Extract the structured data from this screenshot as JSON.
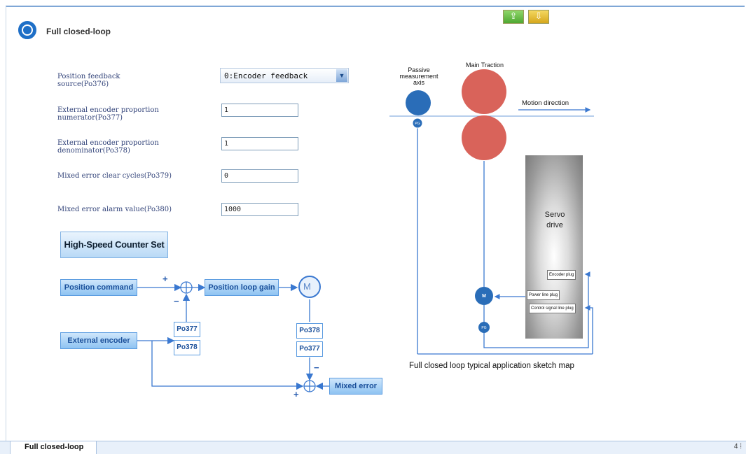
{
  "window": {
    "title": "Full closed-loop"
  },
  "toolbar": {
    "btn_upload": "⇪",
    "btn_download": "⇩"
  },
  "form": {
    "source_label": "Position feedback source(Po376)",
    "source_value": "0:Encoder feedback",
    "numerator_label": "External encoder proportion numerator(Po377)",
    "numerator_value": "1",
    "denominator_label": "External encoder proportion denominator(Po378)",
    "denominator_value": "1",
    "clear_label": "Mixed error clear cycles(Po379)",
    "clear_value": "0",
    "alarm_label": "Mixed error alarm value(Po380)",
    "alarm_value": "1000"
  },
  "hsc_button": "High-Speed Counter Set",
  "block_diagram": {
    "position_command": "Position command",
    "position_loop_gain": "Position loop gain",
    "motor": "M",
    "external_encoder": "External encoder",
    "mixed_error": "Mixed error",
    "p377_a": "Po377",
    "p378_a": "Po378",
    "p378_b": "Po378",
    "p377_b": "Po377",
    "plus1": "+",
    "minus1": "−",
    "minus2": "−",
    "plus2": "+"
  },
  "sketch": {
    "passive_axis": "Passive measurement axis",
    "main_traction": "Main Traction",
    "motion_direction": "Motion direction",
    "pg_top": "PG",
    "servo_drive": "Servo drive",
    "encoder_plug": "Encoder plug",
    "power_plug": "Power line plug",
    "control_plug": "Control signal line plug",
    "motor": "M",
    "pg_bottom": "PG",
    "caption": "Full closed loop typical application sketch map"
  },
  "tabs": {
    "active": "Full closed-loop",
    "page_indicator": "4 ⁞"
  }
}
